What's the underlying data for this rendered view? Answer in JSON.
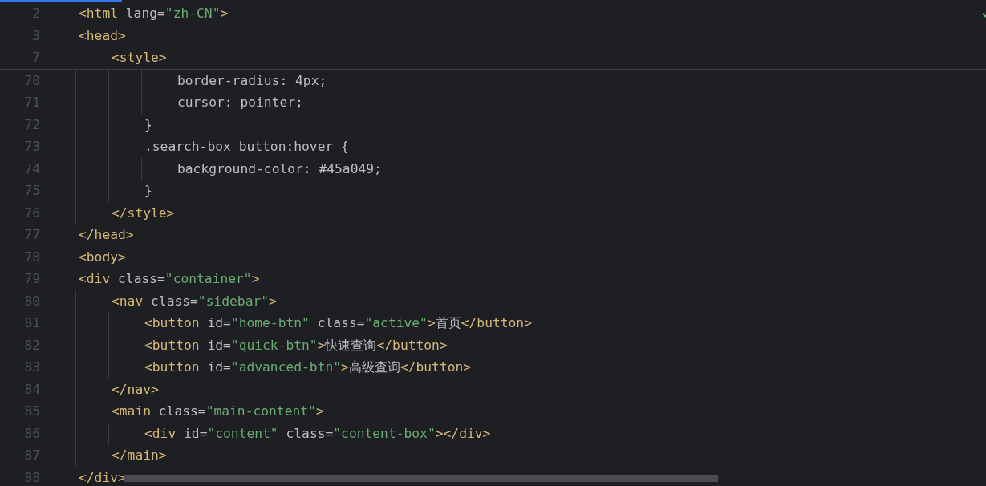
{
  "editor": {
    "sticky_lines": [
      {
        "number": "2",
        "tokens": [
          {
            "kind": "tag",
            "text": "<html"
          },
          {
            "kind": "attr",
            "text": " lang="
          },
          {
            "kind": "string",
            "text": "\"zh-CN\""
          },
          {
            "kind": "tag",
            "text": ">"
          }
        ]
      },
      {
        "number": "3",
        "tokens": [
          {
            "kind": "tag",
            "text": "<head>"
          }
        ]
      },
      {
        "number": "7",
        "tokens": [
          {
            "kind": "tag",
            "text": "    <style>"
          }
        ]
      }
    ],
    "lines": [
      {
        "number": "70",
        "tokens": [
          {
            "kind": "plain",
            "text": "            border-radius: 4px;"
          }
        ]
      },
      {
        "number": "71",
        "tokens": [
          {
            "kind": "plain",
            "text": "            cursor: pointer;"
          }
        ]
      },
      {
        "number": "72",
        "tokens": [
          {
            "kind": "plain",
            "text": "        }"
          }
        ]
      },
      {
        "number": "73",
        "tokens": [
          {
            "kind": "plain",
            "text": "        .search-box button:hover {"
          }
        ]
      },
      {
        "number": "74",
        "tokens": [
          {
            "kind": "plain",
            "text": "            background-color: #45a049;"
          }
        ]
      },
      {
        "number": "75",
        "tokens": [
          {
            "kind": "plain",
            "text": "        }"
          }
        ]
      },
      {
        "number": "76",
        "tokens": [
          {
            "kind": "tag",
            "text": "    </style>"
          }
        ]
      },
      {
        "number": "77",
        "tokens": [
          {
            "kind": "tag",
            "text": "</head>"
          }
        ]
      },
      {
        "number": "78",
        "tokens": [
          {
            "kind": "tag",
            "text": "<body>"
          }
        ]
      },
      {
        "number": "79",
        "tokens": [
          {
            "kind": "tag",
            "text": "<div"
          },
          {
            "kind": "attr",
            "text": " class="
          },
          {
            "kind": "string",
            "text": "\"container\""
          },
          {
            "kind": "tag",
            "text": ">"
          }
        ]
      },
      {
        "number": "80",
        "tokens": [
          {
            "kind": "tag",
            "text": "    <nav"
          },
          {
            "kind": "attr",
            "text": " class="
          },
          {
            "kind": "string",
            "text": "\"sidebar\""
          },
          {
            "kind": "tag",
            "text": ">"
          }
        ]
      },
      {
        "number": "81",
        "tokens": [
          {
            "kind": "tag",
            "text": "        <button"
          },
          {
            "kind": "attr",
            "text": " id="
          },
          {
            "kind": "string",
            "text": "\"home-btn\""
          },
          {
            "kind": "attr",
            "text": " class="
          },
          {
            "kind": "string",
            "text": "\"active\""
          },
          {
            "kind": "tag",
            "text": ">"
          },
          {
            "kind": "plain",
            "text": "首页"
          },
          {
            "kind": "tag",
            "text": "</button>"
          }
        ]
      },
      {
        "number": "82",
        "tokens": [
          {
            "kind": "tag",
            "text": "        <button"
          },
          {
            "kind": "attr",
            "text": " id="
          },
          {
            "kind": "string",
            "text": "\"quick-btn\""
          },
          {
            "kind": "tag",
            "text": ">"
          },
          {
            "kind": "plain",
            "text": "快速查询"
          },
          {
            "kind": "tag",
            "text": "</button>"
          }
        ]
      },
      {
        "number": "83",
        "tokens": [
          {
            "kind": "tag",
            "text": "        <button"
          },
          {
            "kind": "attr",
            "text": " id="
          },
          {
            "kind": "string",
            "text": "\"advanced-btn\""
          },
          {
            "kind": "tag",
            "text": ">"
          },
          {
            "kind": "plain",
            "text": "高级查询"
          },
          {
            "kind": "tag",
            "text": "</button>"
          }
        ]
      },
      {
        "number": "84",
        "tokens": [
          {
            "kind": "tag",
            "text": "    </nav>"
          }
        ]
      },
      {
        "number": "85",
        "tokens": [
          {
            "kind": "tag",
            "text": "    <main"
          },
          {
            "kind": "attr",
            "text": " class="
          },
          {
            "kind": "string",
            "text": "\"main-content\""
          },
          {
            "kind": "tag",
            "text": ">"
          }
        ]
      },
      {
        "number": "86",
        "tokens": [
          {
            "kind": "tag",
            "text": "        <div"
          },
          {
            "kind": "attr",
            "text": " id="
          },
          {
            "kind": "string",
            "text": "\"content\""
          },
          {
            "kind": "attr",
            "text": " class="
          },
          {
            "kind": "string",
            "text": "\"content-box\""
          },
          {
            "kind": "tag",
            "text": "></div>"
          }
        ]
      },
      {
        "number": "87",
        "tokens": [
          {
            "kind": "tag",
            "text": "    </main>"
          }
        ]
      },
      {
        "number": "88",
        "tokens": [
          {
            "kind": "tag",
            "text": "</div>"
          }
        ]
      }
    ]
  }
}
